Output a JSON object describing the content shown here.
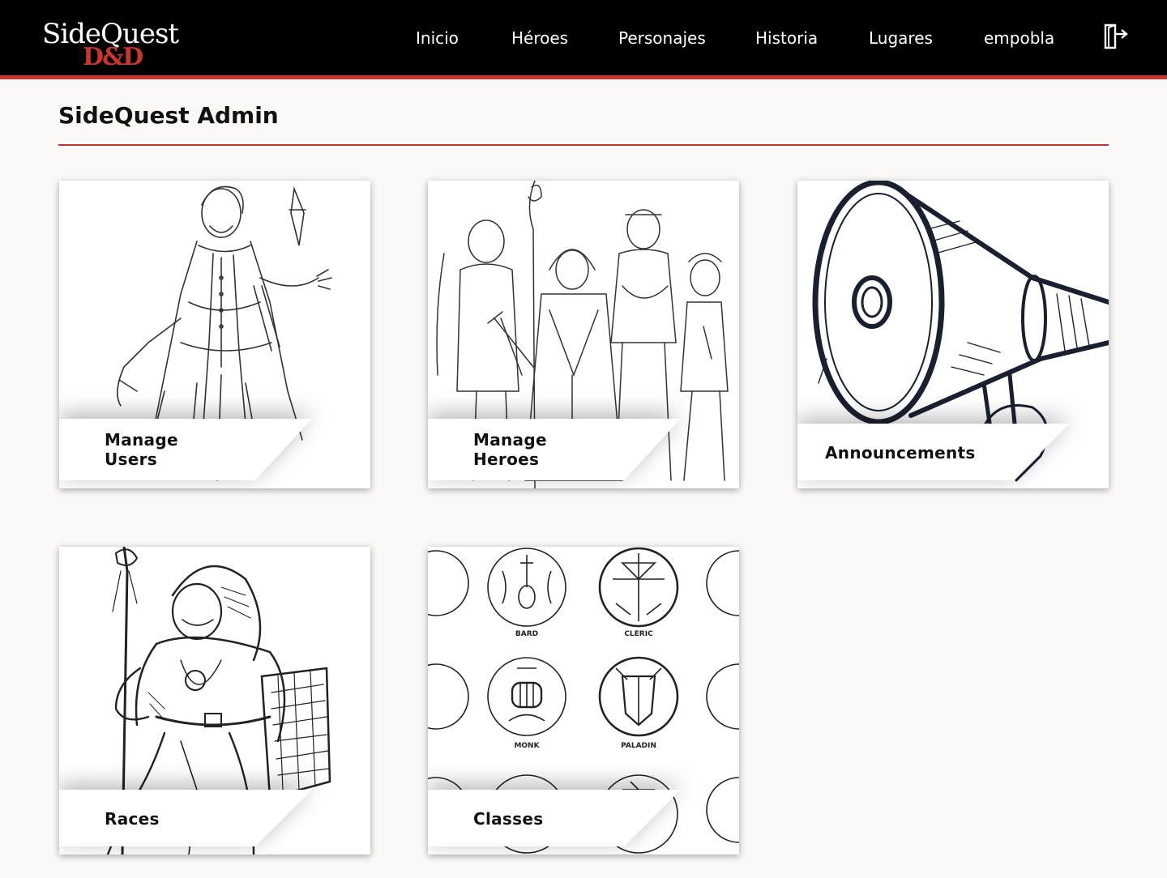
{
  "brand": {
    "logo_top": "SideQuest",
    "logo_bottom": "D&D",
    "accent_color": "#c9372c"
  },
  "nav": {
    "items": [
      {
        "label": "Inicio"
      },
      {
        "label": "Héroes"
      },
      {
        "label": "Personajes"
      },
      {
        "label": "Historia"
      },
      {
        "label": "Lugares"
      },
      {
        "label": "empobla"
      }
    ],
    "logout_icon": "logout-icon"
  },
  "page": {
    "title": "SideQuest Admin"
  },
  "cards": [
    {
      "label": "Manage Users",
      "icon": "rogue-sketch"
    },
    {
      "label": "Manage Heroes",
      "icon": "party-sketch"
    },
    {
      "label": "Announcements",
      "icon": "megaphone-sketch"
    },
    {
      "label": "Races",
      "icon": "orc-sketch"
    },
    {
      "label": "Classes",
      "icon": "class-emblems"
    }
  ],
  "class_emblems": {
    "labels": [
      "BARD",
      "CLERIC",
      "MONK",
      "PALADIN"
    ]
  }
}
